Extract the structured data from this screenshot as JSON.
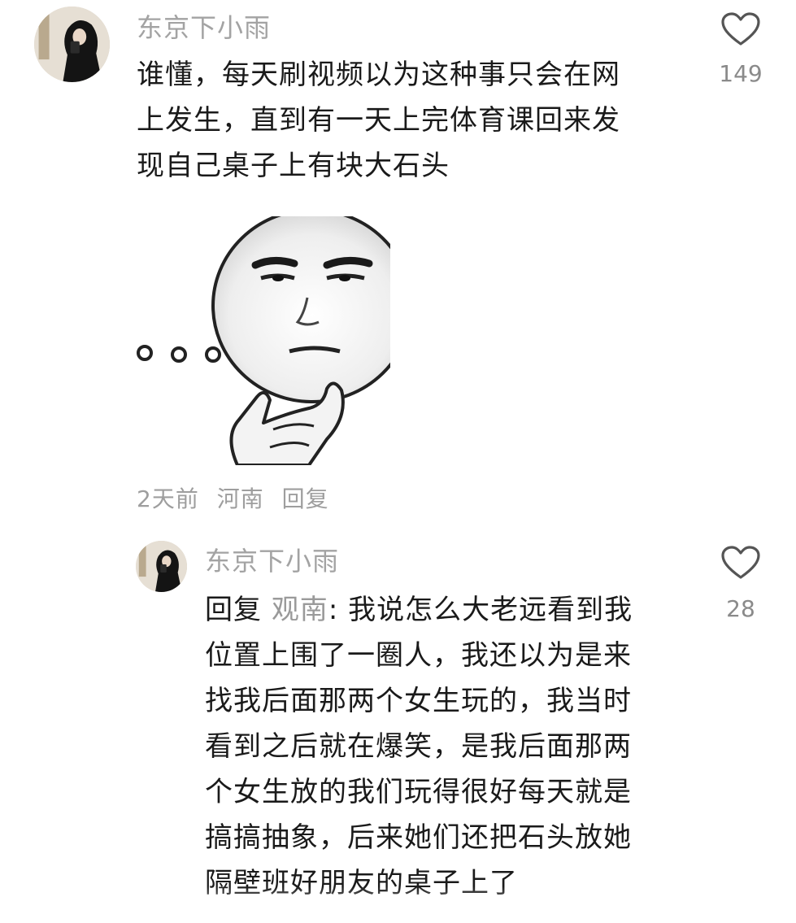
{
  "comment": {
    "username": "东京下小雨",
    "lines": [
      "谁懂，每天刷视频以为这种事只会在网",
      "上发生，直到有一天上完体育课回来发",
      "现自己桌子上有块大石头"
    ],
    "like_count": "149",
    "meta": {
      "time": "2天前",
      "location": "河南",
      "reply_label": "回复"
    },
    "sticker_text": "..."
  },
  "reply": {
    "username": "东京下小雨",
    "reply_prefix": "回复",
    "mention": "观南",
    "lines": [
      ": 我说怎么大老远看到我",
      "位置上围了一圈人，我还以为是来",
      "找我后面那两个女生玩的，我当时",
      "看到之后就在爆笑，是我后面那两",
      "个女生放的我们玩得很好每天就是",
      "搞搞抽象，后来她们还把石头放她",
      "隔壁班好朋友的桌子上了"
    ],
    "like_count": "28"
  },
  "icons": {
    "like": "heart-outline-icon",
    "avatar": "user-avatar"
  }
}
